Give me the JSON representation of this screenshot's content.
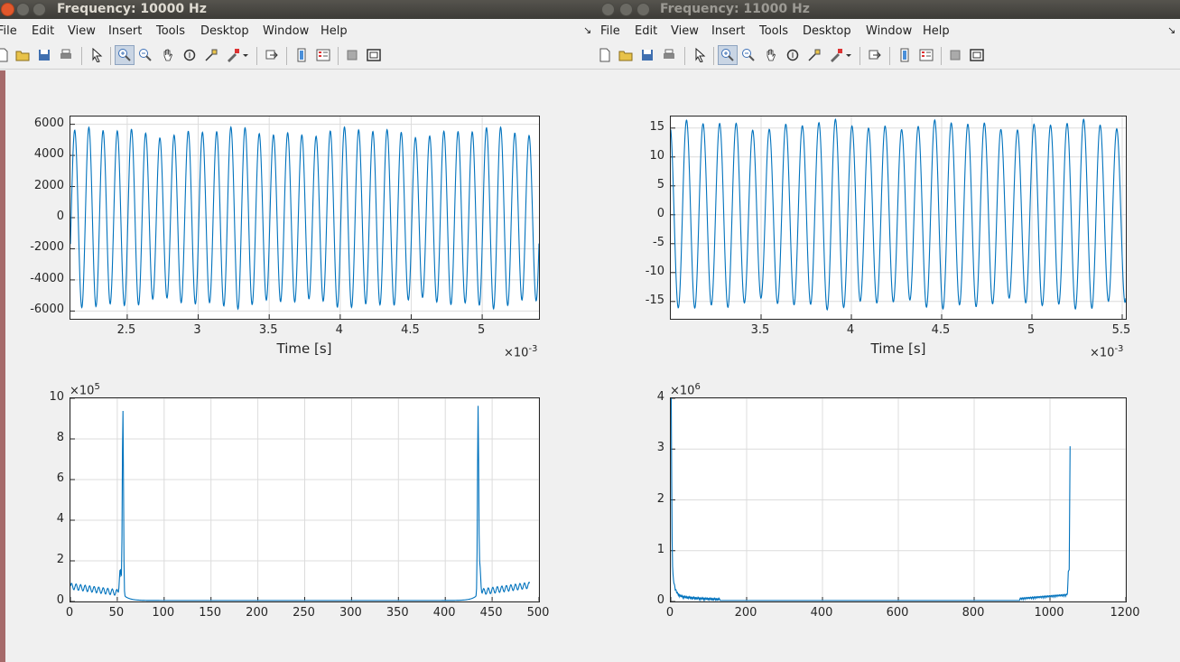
{
  "windows": [
    {
      "title": "Frequency: 10000 Hz",
      "menu": [
        "File",
        "Edit",
        "View",
        "Insert",
        "Tools",
        "Desktop",
        "Window",
        "Help"
      ],
      "plots": {
        "time": {
          "type": "line",
          "xlabel": "Time [s]",
          "x_exponent": "-3",
          "xlim": [
            2.1,
            5.4
          ],
          "ylim": [
            -6500,
            6500
          ],
          "xticks": [
            "2.5",
            "3",
            "3.5",
            "4",
            "4.5",
            "5"
          ],
          "xtick_values": [
            2.5,
            3,
            3.5,
            4,
            4.5,
            5
          ],
          "yticks": [
            "6000",
            "4000",
            "2000",
            "0",
            "-2000",
            "-4000",
            "-6000"
          ],
          "ytick_values": [
            6000,
            4000,
            2000,
            0,
            -2000,
            -4000,
            -6000
          ],
          "signal": {
            "cycles": 33,
            "amplitude": 5500,
            "start_phase": -0.05
          }
        },
        "spectrum": {
          "type": "line",
          "y_exponent": "5",
          "xlim": [
            0,
            500
          ],
          "ylim": [
            0,
            10
          ],
          "xticks": [
            "0",
            "50",
            "100",
            "150",
            "200",
            "250",
            "300",
            "350",
            "400",
            "450",
            "500"
          ],
          "xtick_values": [
            0,
            50,
            100,
            150,
            200,
            250,
            300,
            350,
            400,
            450,
            500
          ],
          "yticks": [
            "10",
            "8",
            "6",
            "4",
            "2",
            "0"
          ],
          "ytick_values": [
            10,
            8,
            6,
            4,
            2,
            0
          ],
          "peaks": [
            {
              "x": 56,
              "y": 9.1
            },
            {
              "x": 435,
              "y": 9.1
            }
          ],
          "xmax_data": 490
        }
      }
    },
    {
      "title": "Frequency: 11000 Hz",
      "menu": [
        "File",
        "Edit",
        "View",
        "Insert",
        "Tools",
        "Desktop",
        "Window",
        "Help"
      ],
      "plots": {
        "time": {
          "type": "line",
          "xlabel": "Time [s]",
          "x_exponent": "-3",
          "xlim": [
            3.0,
            5.52
          ],
          "ylim": [
            -18,
            17
          ],
          "xticks": [
            "3.5",
            "4",
            "4.5",
            "5",
            "5.5"
          ],
          "xtick_values": [
            3.5,
            4,
            4.5,
            5,
            5.5
          ],
          "yticks": [
            "15",
            "10",
            "5",
            "0",
            "-5",
            "-10",
            "-15"
          ],
          "ytick_values": [
            15,
            10,
            5,
            0,
            -5,
            -10,
            -15
          ],
          "signal": {
            "cycles": 27.5,
            "amplitude": 15.5,
            "start_phase": 0.3
          }
        },
        "spectrum": {
          "type": "line",
          "y_exponent": "6",
          "xlim": [
            0,
            1200
          ],
          "ylim": [
            0,
            4
          ],
          "xticks": [
            "0",
            "200",
            "400",
            "600",
            "800",
            "1000",
            "1200"
          ],
          "xtick_values": [
            0,
            200,
            400,
            600,
            800,
            1000,
            1200
          ],
          "yticks": [
            "4",
            "3",
            "2",
            "1",
            "0"
          ],
          "ytick_values": [
            4,
            3,
            2,
            1,
            0
          ],
          "peaks": [
            {
              "x": 0,
              "y": 3.8
            },
            {
              "x": 1053,
              "y": 2.9
            }
          ],
          "xmax_data": 1053
        }
      }
    }
  ],
  "colors": {
    "line": "#0072bd",
    "grid": "#dcdcdc"
  }
}
